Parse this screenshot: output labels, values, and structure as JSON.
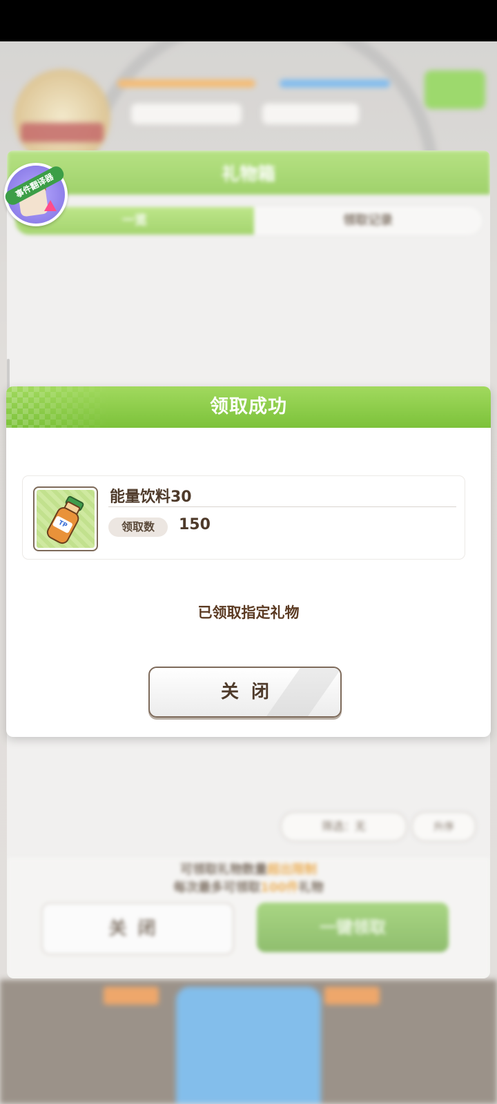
{
  "background": {
    "gift_box_title": "礼物箱",
    "tabs": [
      {
        "label": "一览",
        "active": true
      },
      {
        "label": "领取记录",
        "active": false
      }
    ],
    "sort_label": "筛选：无",
    "filter_label": "升序",
    "note_line1_pre": "可领取礼物数量",
    "note_line1_hl": "超出限制",
    "note_line2_pre": "每次最多可领取",
    "note_line2_hl": "100件",
    "note_line2_post": "礼物",
    "close_label": "关闭",
    "claim_all_label": "一键领取",
    "event_badge_label": "事件翻译器"
  },
  "modal": {
    "title": "领取成功",
    "item": {
      "name": "能量饮料30",
      "icon": "energy-drink-bottle-icon",
      "icon_label": "TP",
      "qty_label": "领取数",
      "qty_value": "150"
    },
    "message": "已领取指定礼物",
    "close_label": "关闭"
  },
  "colors": {
    "header_green": "#8cc84b",
    "text_brown": "#4e3a2a",
    "accent_orange": "#e69a2c"
  }
}
